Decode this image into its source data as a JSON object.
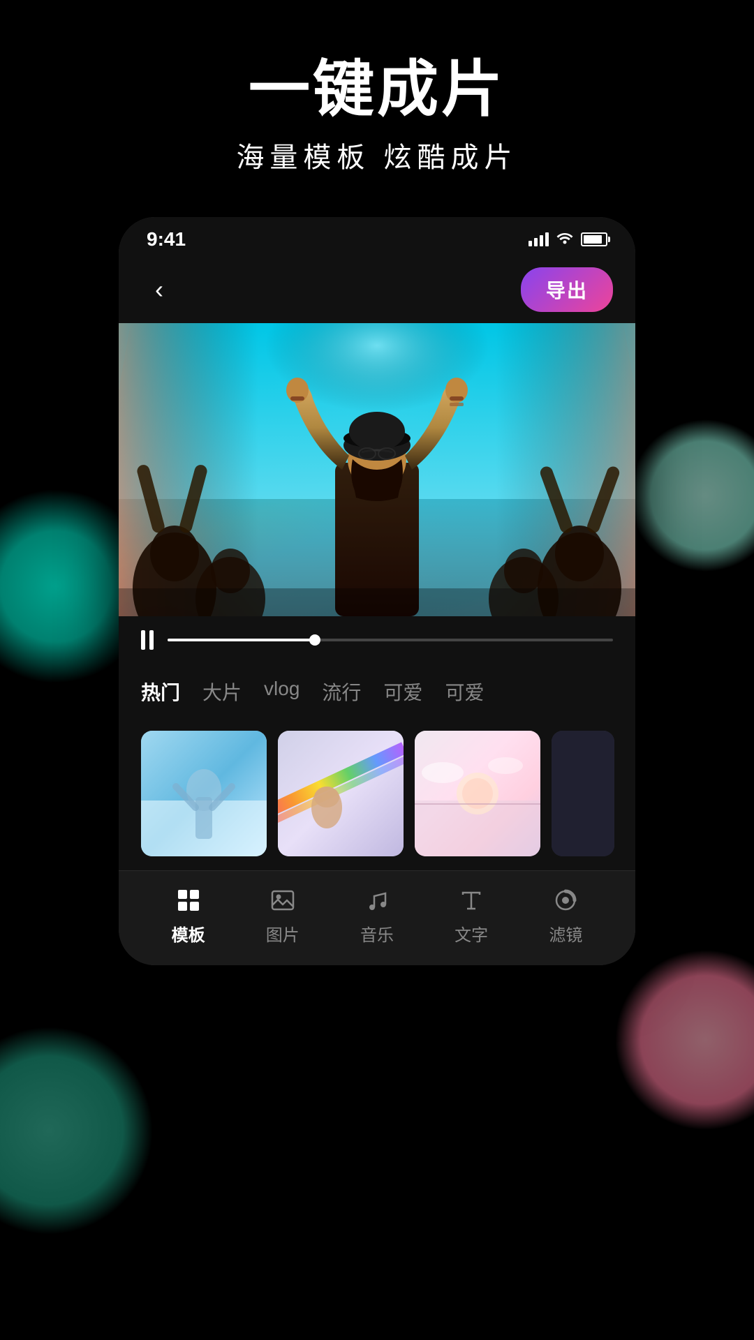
{
  "background": {
    "color": "#000000"
  },
  "header": {
    "title": "一键成片",
    "subtitle": "海量模板   炫酷成片"
  },
  "phone": {
    "status_bar": {
      "time": "9:41",
      "signal": "signal",
      "wifi": "wifi",
      "battery": "battery"
    },
    "nav": {
      "back_label": "<",
      "export_label": "导出"
    },
    "video": {
      "description": "Concert crowd scene"
    },
    "playback": {
      "progress_percent": 33
    },
    "category_tabs": [
      {
        "label": "热门",
        "active": true
      },
      {
        "label": "大片",
        "active": false
      },
      {
        "label": "vlog",
        "active": false
      },
      {
        "label": "流行",
        "active": false
      },
      {
        "label": "可爱",
        "active": false
      },
      {
        "label": "可爱",
        "active": false
      }
    ],
    "toolbar": {
      "items": [
        {
          "label": "模板",
          "active": true,
          "icon": "template-icon"
        },
        {
          "label": "图片",
          "active": false,
          "icon": "image-icon"
        },
        {
          "label": "音乐",
          "active": false,
          "icon": "music-icon"
        },
        {
          "label": "文字",
          "active": false,
          "icon": "text-icon"
        },
        {
          "label": "滤镜",
          "active": false,
          "icon": "filter-icon"
        }
      ]
    }
  }
}
